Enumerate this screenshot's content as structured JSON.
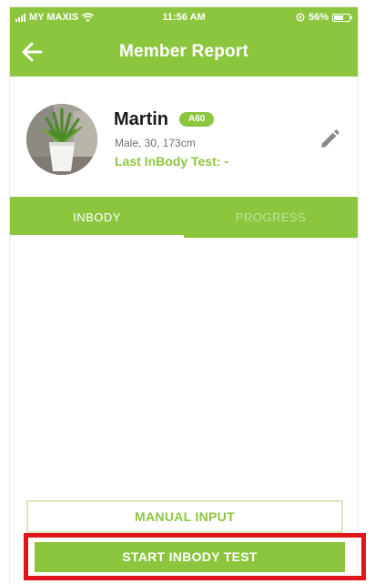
{
  "status_bar": {
    "carrier": "MY MAXIS",
    "time": "11:56 AM",
    "battery_percent": "56%",
    "battery_level": 0.56,
    "icons": [
      "signal-icon",
      "wifi-icon",
      "location-icon",
      "battery-icon"
    ]
  },
  "navbar": {
    "title": "Member Report",
    "back_icon": "arrow-left-icon"
  },
  "member": {
    "name": "Martin",
    "badge": "A60",
    "info": "Male, 30, 173cm",
    "last_test": "Last InBody Test: -",
    "edit_icon": "pencil-icon",
    "avatar": "plant-photo"
  },
  "tabs": [
    {
      "label": "INBODY",
      "active": true
    },
    {
      "label": "PROGRESS",
      "active": false
    }
  ],
  "buttons": {
    "manual_input": "MANUAL INPUT",
    "start_test": "START INBODY TEST"
  },
  "colors": {
    "brand_green": "#8cc63f",
    "highlight_red": "#e0141a",
    "text_dark": "#1c1c1c",
    "text_grey": "#6f6f6f"
  }
}
